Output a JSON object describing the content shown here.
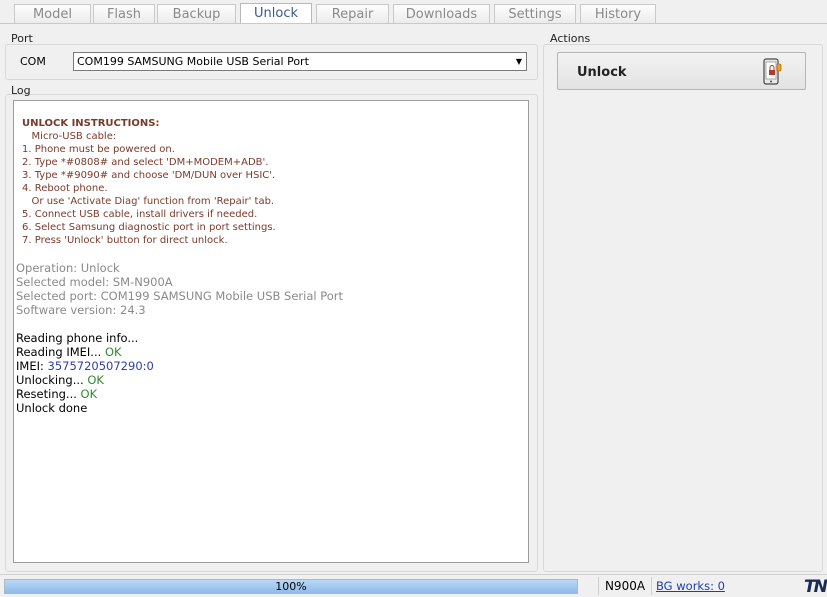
{
  "tabs": [
    {
      "label": "Model",
      "active": false
    },
    {
      "label": "Flash",
      "active": false
    },
    {
      "label": "Backup",
      "active": false
    },
    {
      "label": "Unlock",
      "active": true
    },
    {
      "label": "Repair",
      "active": false
    },
    {
      "label": "Downloads",
      "active": false
    },
    {
      "label": "Settings",
      "active": false
    },
    {
      "label": "History",
      "active": false
    }
  ],
  "port": {
    "group_label": "Port",
    "com_label": "COM",
    "selected": "COM199 SAMSUNG Mobile USB Serial Port",
    "arrow": "▼"
  },
  "log": {
    "group_label": "Log",
    "instructions": {
      "title": "UNLOCK INSTRUCTIONS:",
      "lines": [
        "   Micro-USB cable:",
        "1. Phone must be powered on.",
        "2. Type *#0808# and select 'DM+MODEM+ADB'.",
        "3. Type *#9090# and choose 'DM/DUN over HSIC'.",
        "4. Reboot phone.",
        "   Or use 'Activate Diag' function from 'Repair' tab.",
        "5. Connect USB cable, install drivers if needed.",
        "6. Select Samsung diagnostic port in port settings.",
        "7. Press 'Unlock' button for direct unlock."
      ]
    },
    "info_lines": [
      "Operation: Unlock",
      "Selected model: SM-N900A",
      "Selected port: COM199 SAMSUNG Mobile USB Serial Port",
      "Software version: 24.3"
    ],
    "reading_info": "Reading phone info...",
    "reading_imei": "Reading IMEI... ",
    "reading_imei_ok": "OK",
    "imei_label": "IMEI: ",
    "imei_value": "3575720507290:0",
    "unlocking": "Unlocking... ",
    "unlocking_ok": "OK",
    "reseting": "Reseting... ",
    "reseting_ok": "OK",
    "done": "Unlock done"
  },
  "actions": {
    "group_label": "Actions",
    "unlock_label": "Unlock",
    "icon": "phone-unlock-icon"
  },
  "status": {
    "progress_text": "100%",
    "progress_value": 1.0,
    "model": "N900A",
    "bg_works": "BG works: 0",
    "logo": "TN"
  },
  "colors": {
    "instructions": "#7a3a2a",
    "ok": "#2e8b2e",
    "imei": "#2f3fa0",
    "progress": "#8fbbe9"
  }
}
